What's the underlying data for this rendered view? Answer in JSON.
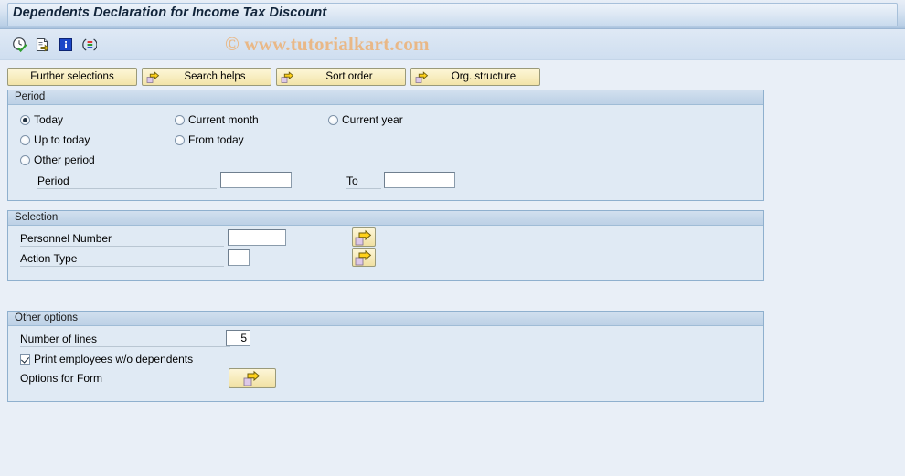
{
  "window": {
    "title": "Dependents Declaration for Income Tax Discount"
  },
  "watermark": {
    "text": "© www.tutorialkart.com"
  },
  "toolbar": {
    "icons": [
      {
        "name": "execute-clock-icon",
        "title": "Execute"
      },
      {
        "name": "get-variant-icon",
        "title": "Get Variant"
      },
      {
        "name": "info-icon",
        "title": "Information"
      },
      {
        "name": "variant-attributes-icon",
        "title": "Variant Attributes"
      }
    ]
  },
  "buttons": [
    {
      "label": "Further selections",
      "icon": "none"
    },
    {
      "label": "Search helps",
      "icon": "yellow-arrow-icon"
    },
    {
      "label": "Sort order",
      "icon": "yellow-arrow-icon"
    },
    {
      "label": "Org. structure",
      "icon": "yellow-arrow-icon"
    }
  ],
  "period": {
    "header": "Period",
    "options": [
      {
        "label": "Today",
        "selected": true
      },
      {
        "label": "Current month",
        "selected": false
      },
      {
        "label": "Current year",
        "selected": false
      },
      {
        "label": "Up to today",
        "selected": false
      },
      {
        "label": "From today",
        "selected": false
      },
      {
        "label": "Other period",
        "selected": false
      }
    ],
    "period_label": "Period",
    "period_value": "",
    "to_label": "To",
    "to_value": ""
  },
  "selection": {
    "header": "Selection",
    "personnel_number_label": "Personnel Number",
    "personnel_number_value": "",
    "action_type_label": "Action Type",
    "action_type_value": ""
  },
  "other_options": {
    "header": "Other options",
    "number_of_lines_label": "Number of lines",
    "number_of_lines_value": "5",
    "print_employees_label": "Print employees w/o dependents",
    "print_employees_checked": true,
    "options_for_form_label": "Options for Form"
  },
  "colors": {
    "background": "#e9eff7",
    "panel": "#e0eaf4",
    "panel_border": "#8fb0ce",
    "button_yellow": "#f8eec2",
    "watermark": "#e9b887",
    "arrow_yellow": "#ffd11a"
  }
}
